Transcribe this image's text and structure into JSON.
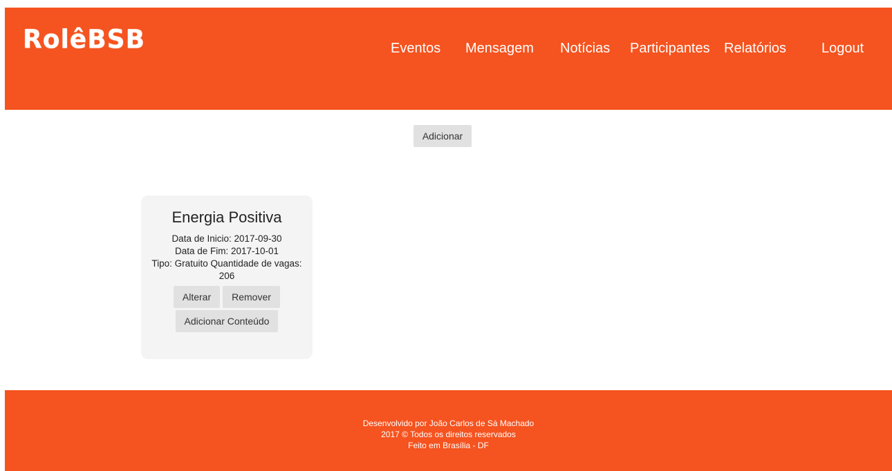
{
  "colors": {
    "brand": "#F5531F",
    "button_bg": "#E1E1E1",
    "card_bg": "#F4F4F4"
  },
  "header": {
    "logo": "RolêBSB",
    "nav": {
      "eventos": "Eventos",
      "mensagem": "Mensagem",
      "noticias": "Notícias",
      "participantes": "Participantes",
      "relatorios": "Relatórios",
      "logout": "Logout"
    }
  },
  "main": {
    "add_button": "Adicionar",
    "event": {
      "title": "Energia Positiva",
      "start": "Data de Inicio: 2017-09-30",
      "end": "Data de Fim: 2017-10-01",
      "type_line": "Tipo: Gratuito Quantidade de vagas:",
      "vacancies": "206",
      "edit_button": "Alterar",
      "remove_button": "Remover",
      "add_content_button": "Adicionar Conteúdo"
    }
  },
  "footer": {
    "line1": "Desenvolvido por João Carlos de Sá Machado",
    "line2": "2017 © Todos os direitos reservados",
    "line3": "Feito em Brasília - DF"
  }
}
